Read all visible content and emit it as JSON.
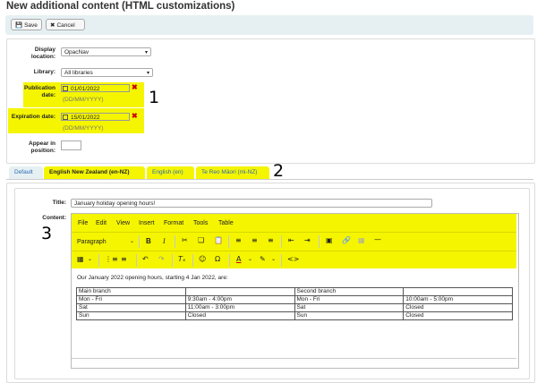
{
  "page": {
    "title": "New additional content (HTML customizations)"
  },
  "toolbar": {
    "save_label": "Save",
    "cancel_label": "Cancel"
  },
  "form": {
    "display_location_label": "Display location:",
    "display_location_value": "OpacNav",
    "library_label": "Library:",
    "library_value": "All libraries",
    "publication_date_label": "Publication date:",
    "publication_date_value": "01/01/2022",
    "publication_date_hint": "(DD/MM/YYYY)",
    "expiration_date_label": "Expiration date:",
    "expiration_date_value": "15/01/2022",
    "expiration_date_hint": "(DD/MM/YYYY)",
    "appear_in_position_label": "Appear in position:",
    "appear_in_position_value": ""
  },
  "annotations": {
    "one": "1",
    "two": "2",
    "three": "3"
  },
  "tabs": [
    {
      "label": "Default"
    },
    {
      "label": "English New Zealand (en-NZ)"
    },
    {
      "label": "English (en)"
    },
    {
      "label": "Te Reo Māori (mi-NZ)"
    }
  ],
  "content_form": {
    "title_label": "Title:",
    "title_value": "January holiday opening hours!",
    "content_label": "Content:"
  },
  "editor": {
    "menu": [
      "File",
      "Edit",
      "View",
      "Insert",
      "Format",
      "Tools",
      "Table"
    ],
    "paragraph_select": "Paragraph",
    "intro_text": "Our January 2022 opening hours, starting 4 Jan 2022, are:",
    "table": [
      [
        "Main branch",
        "",
        "Second branch",
        ""
      ],
      [
        "Mon - Fri",
        "9:30am - 4:00pm",
        "Mon - Fri",
        "10:00am - 5:00pm"
      ],
      [
        "Sat",
        "11:00am - 3:00pm",
        "Sat",
        "Closed"
      ],
      [
        "Sun",
        "Closed",
        "Sun",
        "Closed"
      ]
    ]
  },
  "colors": {
    "highlight": "#f5f500",
    "tab_blue": "#2a6bb5",
    "error_red": "#cc0000"
  },
  "icons": [
    "save-icon",
    "cancel-icon",
    "calendar-icon",
    "clear-icon",
    "bold-icon",
    "italic-icon",
    "cut-icon",
    "copy-icon",
    "paste-icon",
    "align-left-icon",
    "align-center-icon",
    "align-right-icon",
    "outdent-icon",
    "indent-icon",
    "image-icon",
    "link-icon",
    "unlink-icon",
    "hr-icon",
    "table-icon",
    "bullet-list-icon",
    "numbered-list-icon",
    "undo-icon",
    "redo-icon",
    "clear-format-icon",
    "emoji-icon",
    "omega-icon",
    "text-color-icon",
    "highlight-icon",
    "code-icon"
  ]
}
